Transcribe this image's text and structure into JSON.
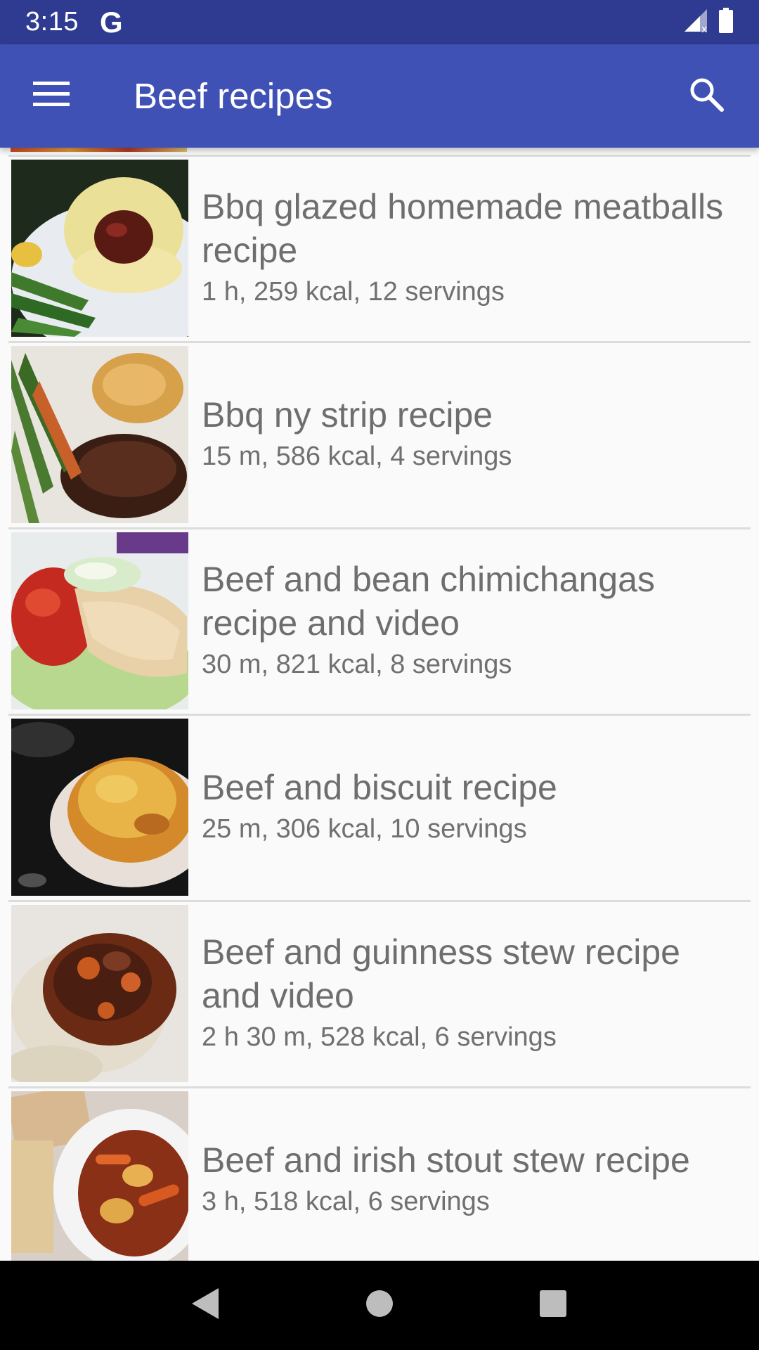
{
  "status": {
    "time": "3:15",
    "carrier_glyph": "G",
    "icons": [
      "signal-icon",
      "battery-icon"
    ]
  },
  "appbar": {
    "title": "Beef recipes",
    "menu_icon": "menu-icon",
    "search_icon": "search-icon",
    "color": "#3f51b5"
  },
  "recipes": [
    {
      "title": "Bbq glazed homemade meatballs recipe",
      "meta": "1 h, 259 kcal, 12 servings"
    },
    {
      "title": "Bbq ny strip recipe",
      "meta": "15 m, 586 kcal, 4 servings"
    },
    {
      "title": "Beef and bean chimichangas recipe and video",
      "meta": "30 m, 821 kcal, 8 servings"
    },
    {
      "title": "Beef and biscuit recipe",
      "meta": "25 m, 306 kcal, 10 servings"
    },
    {
      "title": "Beef and guinness stew recipe and video",
      "meta": "2 h 30 m, 528 kcal, 6 servings"
    },
    {
      "title": "Beef and irish stout stew recipe",
      "meta": "3 h, 518 kcal, 6 servings"
    }
  ],
  "navbar": {
    "back_icon": "back-icon",
    "home_icon": "home-icon",
    "recents_icon": "recents-icon"
  }
}
